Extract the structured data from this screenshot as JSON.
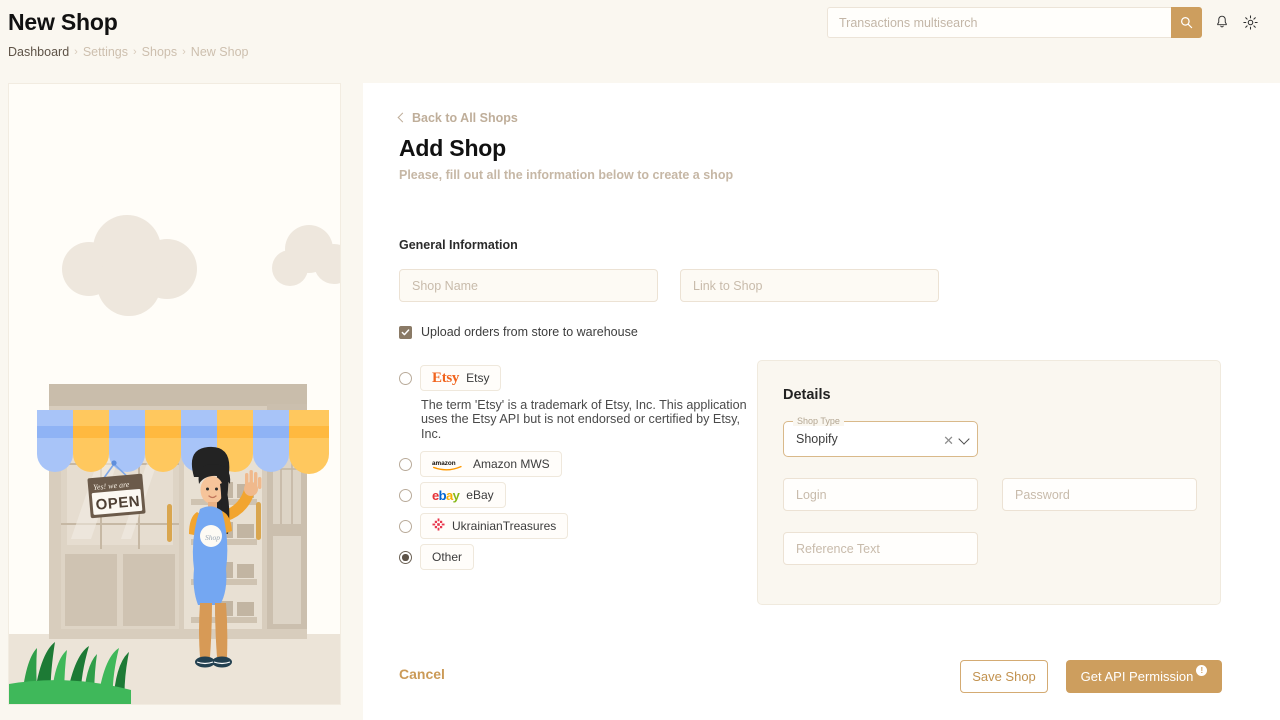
{
  "header": {
    "title": "New Shop",
    "breadcrumb": [
      {
        "label": "Dashboard",
        "active": true
      },
      {
        "label": "Settings",
        "active": false
      },
      {
        "label": "Shops",
        "active": false
      },
      {
        "label": "New Shop",
        "active": false
      }
    ],
    "separator": "›",
    "search": {
      "placeholder": "Transactions multisearch",
      "value": "",
      "button_icon": "search-icon"
    },
    "icons": [
      "bell-icon",
      "gear-icon"
    ]
  },
  "illustration": {
    "name": "shop-storefront-illustration",
    "sign_line1": "Yes! we are",
    "sign_line2": "OPEN"
  },
  "main": {
    "back_link": "Back to All Shops",
    "title": "Add Shop",
    "subtitle": "Please, fill out all the information below to create a shop",
    "section_label": "General Information",
    "fields": {
      "shop_name": {
        "placeholder": "Shop Name",
        "value": ""
      },
      "link_to_shop": {
        "placeholder": "Link to Shop",
        "value": ""
      }
    },
    "checkbox": {
      "label": "Upload orders from store to warehouse",
      "checked": true
    },
    "shop_types": [
      {
        "id": "etsy",
        "label": "Etsy",
        "logo": "etsy-logo",
        "selected": false
      },
      {
        "id": "amazon",
        "label": "Amazon MWS",
        "logo": "amazon-logo",
        "selected": false
      },
      {
        "id": "ebay",
        "label": "eBay",
        "logo": "ebay-logo",
        "selected": false
      },
      {
        "id": "ukrainiantreasures",
        "label": "UkrainianTreasures",
        "logo": "ukrainiantreasures-logo",
        "selected": false
      },
      {
        "id": "other",
        "label": "Other",
        "logo": "",
        "selected": true
      }
    ],
    "etsy_note": "The term 'Etsy' is a trademark of Etsy, Inc. This application uses the Etsy API but is not endorsed or certified by Etsy, Inc.",
    "details": {
      "title": "Details",
      "shop_type": {
        "legend": "Shop Type",
        "value": "Shopify",
        "clear_icon": "✕",
        "dropdown_icon": "chevron-down-icon"
      },
      "login": {
        "placeholder": "Login",
        "value": ""
      },
      "password": {
        "placeholder": "Password",
        "value": ""
      },
      "reference_text": {
        "placeholder": "Reference Text",
        "value": ""
      }
    },
    "footer": {
      "cancel": "Cancel",
      "save": "Save Shop",
      "get_api": "Get API Permission",
      "api_badge": "!"
    }
  },
  "colors": {
    "accent": "#cd9e5e",
    "page_bg": "#faf7f0",
    "etsy_orange": "#f1641e",
    "border": "#ece2d4"
  }
}
